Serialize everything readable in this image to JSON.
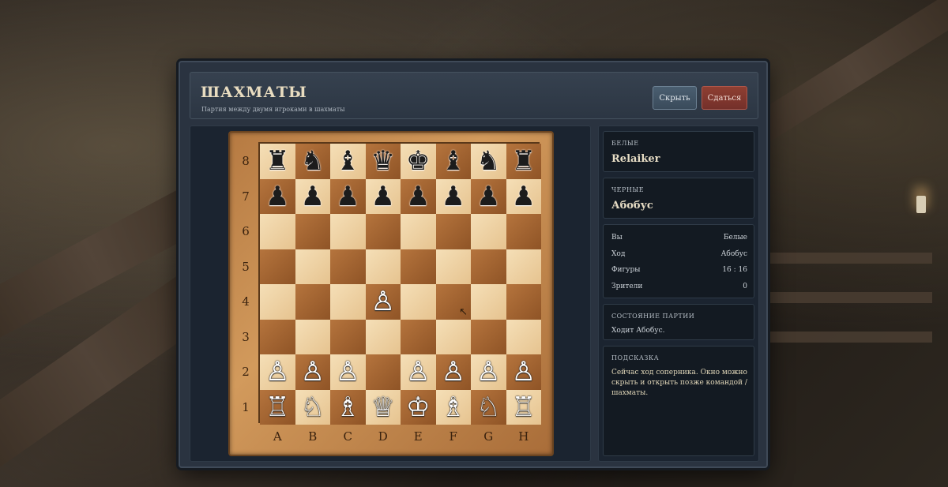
{
  "window": {
    "title": "ШАХМАТЫ",
    "subtitle": "Партия между двумя игроками в шахматы",
    "hide_label": "Скрыть",
    "resign_label": "Сдаться"
  },
  "board": {
    "ranks": [
      "8",
      "7",
      "6",
      "5",
      "4",
      "3",
      "2",
      "1"
    ],
    "files": [
      "A",
      "B",
      "C",
      "D",
      "E",
      "F",
      "G",
      "H"
    ],
    "rows": [
      [
        "♜",
        "♞",
        "♝",
        "♛",
        "♚",
        "♝",
        "♞",
        "♜"
      ],
      [
        "♟",
        "♟",
        "♟",
        "♟",
        "♟",
        "♟",
        "♟",
        "♟"
      ],
      [
        "",
        "",
        "",
        "",
        "",
        "",
        "",
        ""
      ],
      [
        "",
        "",
        "",
        "",
        "",
        "",
        "",
        ""
      ],
      [
        "",
        "",
        "",
        "♙",
        "",
        "",
        "",
        ""
      ],
      [
        "",
        "",
        "",
        "",
        "",
        "",
        "",
        ""
      ],
      [
        "♙",
        "♙",
        "♙",
        "",
        "♙",
        "♙",
        "♙",
        "♙"
      ],
      [
        "♖",
        "♘",
        "♗",
        "♕",
        "♔",
        "♗",
        "♘",
        "♖"
      ]
    ],
    "colors": [
      [
        "b",
        "b",
        "b",
        "b",
        "b",
        "b",
        "b",
        "b"
      ],
      [
        "b",
        "b",
        "b",
        "b",
        "b",
        "b",
        "b",
        "b"
      ],
      [
        "",
        "",
        "",
        "",
        "",
        "",
        "",
        ""
      ],
      [
        "",
        "",
        "",
        "",
        "",
        "",
        "",
        ""
      ],
      [
        "",
        "",
        "",
        "w",
        "",
        "",
        "",
        ""
      ],
      [
        "",
        "",
        "",
        "",
        "",
        "",
        "",
        ""
      ],
      [
        "w",
        "w",
        "w",
        "",
        "w",
        "w",
        "w",
        "w"
      ],
      [
        "w",
        "w",
        "w",
        "w",
        "w",
        "w",
        "w",
        "w"
      ]
    ]
  },
  "players": {
    "white_label": "БЕЛЫЕ",
    "white_name": "Relaiker",
    "black_label": "ЧЕРНЫЕ",
    "black_name": "Абобус"
  },
  "stats": [
    {
      "key": "Вы",
      "value": "Белые"
    },
    {
      "key": "Ход",
      "value": "Абобус"
    },
    {
      "key": "Фигуры",
      "value": "16 : 16"
    },
    {
      "key": "Зрители",
      "value": "0"
    }
  ],
  "status": {
    "label": "СОСТОЯНИЕ ПАРТИИ",
    "text": "Ходит Абобус."
  },
  "hint": {
    "label": "ПОДСКАЗКА",
    "text": "Сейчас ход соперника. Окно можно скрыть и открыть позже командой /шахматы."
  }
}
